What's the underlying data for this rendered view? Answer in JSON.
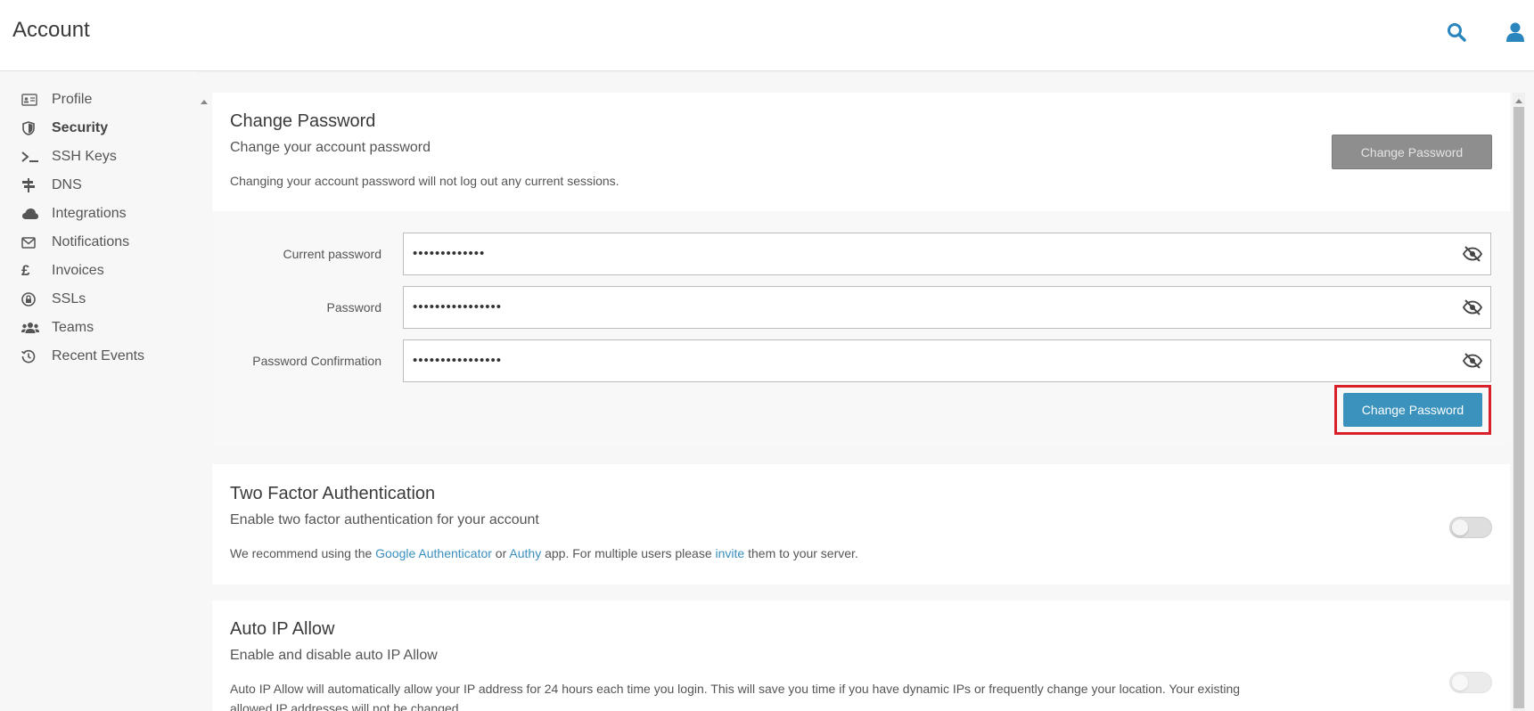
{
  "header": {
    "title": "Account"
  },
  "icons": {
    "search": "search-icon",
    "user": "user-icon"
  },
  "colors": {
    "accent": "#3a92bd",
    "link": "#3a8fbf",
    "highlight_border": "#d9202a",
    "disabled_button": "#8e8e8e"
  },
  "sidebar": {
    "items": [
      {
        "label": "Profile",
        "icon": "id-card-icon",
        "active": false
      },
      {
        "label": "Security",
        "icon": "shield-icon",
        "active": true
      },
      {
        "label": "SSH Keys",
        "icon": "terminal-icon",
        "active": false
      },
      {
        "label": "DNS",
        "icon": "signpost-icon",
        "active": false
      },
      {
        "label": "Integrations",
        "icon": "cloud-icon",
        "active": false
      },
      {
        "label": "Notifications",
        "icon": "envelope-icon",
        "active": false
      },
      {
        "label": "Invoices",
        "icon": "pound-icon",
        "active": false
      },
      {
        "label": "SSLs",
        "icon": "lock-badge-icon",
        "active": false
      },
      {
        "label": "Teams",
        "icon": "users-icon",
        "active": false
      },
      {
        "label": "Recent Events",
        "icon": "history-icon",
        "active": false
      }
    ]
  },
  "change_password": {
    "title": "Change Password",
    "subtitle": "Change your account password",
    "note": "Changing your account password will not log out any current sessions.",
    "top_button_label": "Change Password",
    "fields": [
      {
        "label": "Current password",
        "value": "•••••••••••••"
      },
      {
        "label": "Password",
        "value": "••••••••••••••••"
      },
      {
        "label": "Password Confirmation",
        "value": "••••••••••••••••"
      }
    ],
    "submit_label": "Change Password"
  },
  "two_factor": {
    "title": "Two Factor Authentication",
    "subtitle": "Enable two factor authentication for your account",
    "note_parts": {
      "p1": "We recommend using the ",
      "link1": "Google Authenticator",
      "p2": " or ",
      "link2": "Authy",
      "p3": " app. For multiple users please ",
      "link3": "invite",
      "p4": " them to your server."
    },
    "enabled": false
  },
  "auto_ip": {
    "title": "Auto IP Allow",
    "subtitle": "Enable and disable auto IP Allow",
    "note_line1": "Auto IP Allow will automatically allow your IP address for 24 hours each time you login. This will save you time if you have dynamic IPs or frequently change your location. Your existing",
    "note_line2": "allowed IP addresses will not be changed.",
    "enabled": false
  }
}
